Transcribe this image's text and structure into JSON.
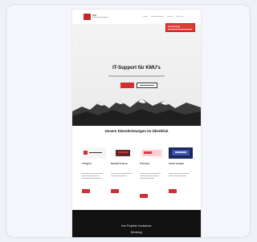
{
  "header": {
    "logo_text": "ILB",
    "nav": [
      "Home",
      "Dienstleistungen",
      "Kontakt",
      "Über uns"
    ],
    "promo": "Fernwartung"
  },
  "hero": {
    "title": "IT-Support für KMU's"
  },
  "services": {
    "title": "Unsere Dienstleistungen im Überblick",
    "items": [
      {
        "title": "IT Support"
      },
      {
        "title": "Netzwerk & Server"
      },
      {
        "title": "IT Security"
      },
      {
        "title": "Cloud Lösungen"
      }
    ]
  },
  "footer": {
    "line1": "Ihre Projekte: kostenlose",
    "line2": "Beratung"
  },
  "colors": {
    "accent": "#d32f2f",
    "dark": "#121212"
  }
}
